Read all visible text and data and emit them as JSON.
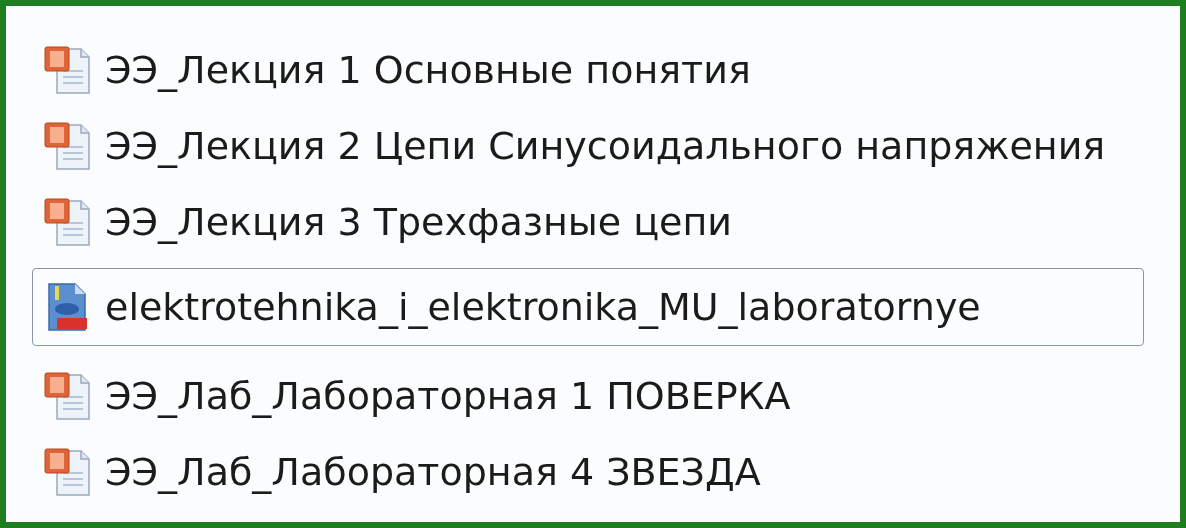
{
  "files": [
    {
      "name": "ЭЭ_Лекция 1 Основные понятия",
      "kind": "pptx",
      "focused": false
    },
    {
      "name": "ЭЭ_Лекция 2 Цепи Синусоидального напряжения",
      "kind": "pptx",
      "focused": false
    },
    {
      "name": "ЭЭ_Лекция 3 Трехфазные цепи",
      "kind": "pptx",
      "focused": false
    },
    {
      "name": "elektrotehnika_i_elektronika_MU_laboratornye",
      "kind": "pdf",
      "focused": true
    },
    {
      "name": "ЭЭ_Лаб_Лабораторная 1 ПОВЕРКА",
      "kind": "pptx",
      "focused": false
    },
    {
      "name": "ЭЭ_Лаб_Лабораторная 4 ЗВЕЗДА",
      "kind": "pptx",
      "focused": false
    }
  ]
}
